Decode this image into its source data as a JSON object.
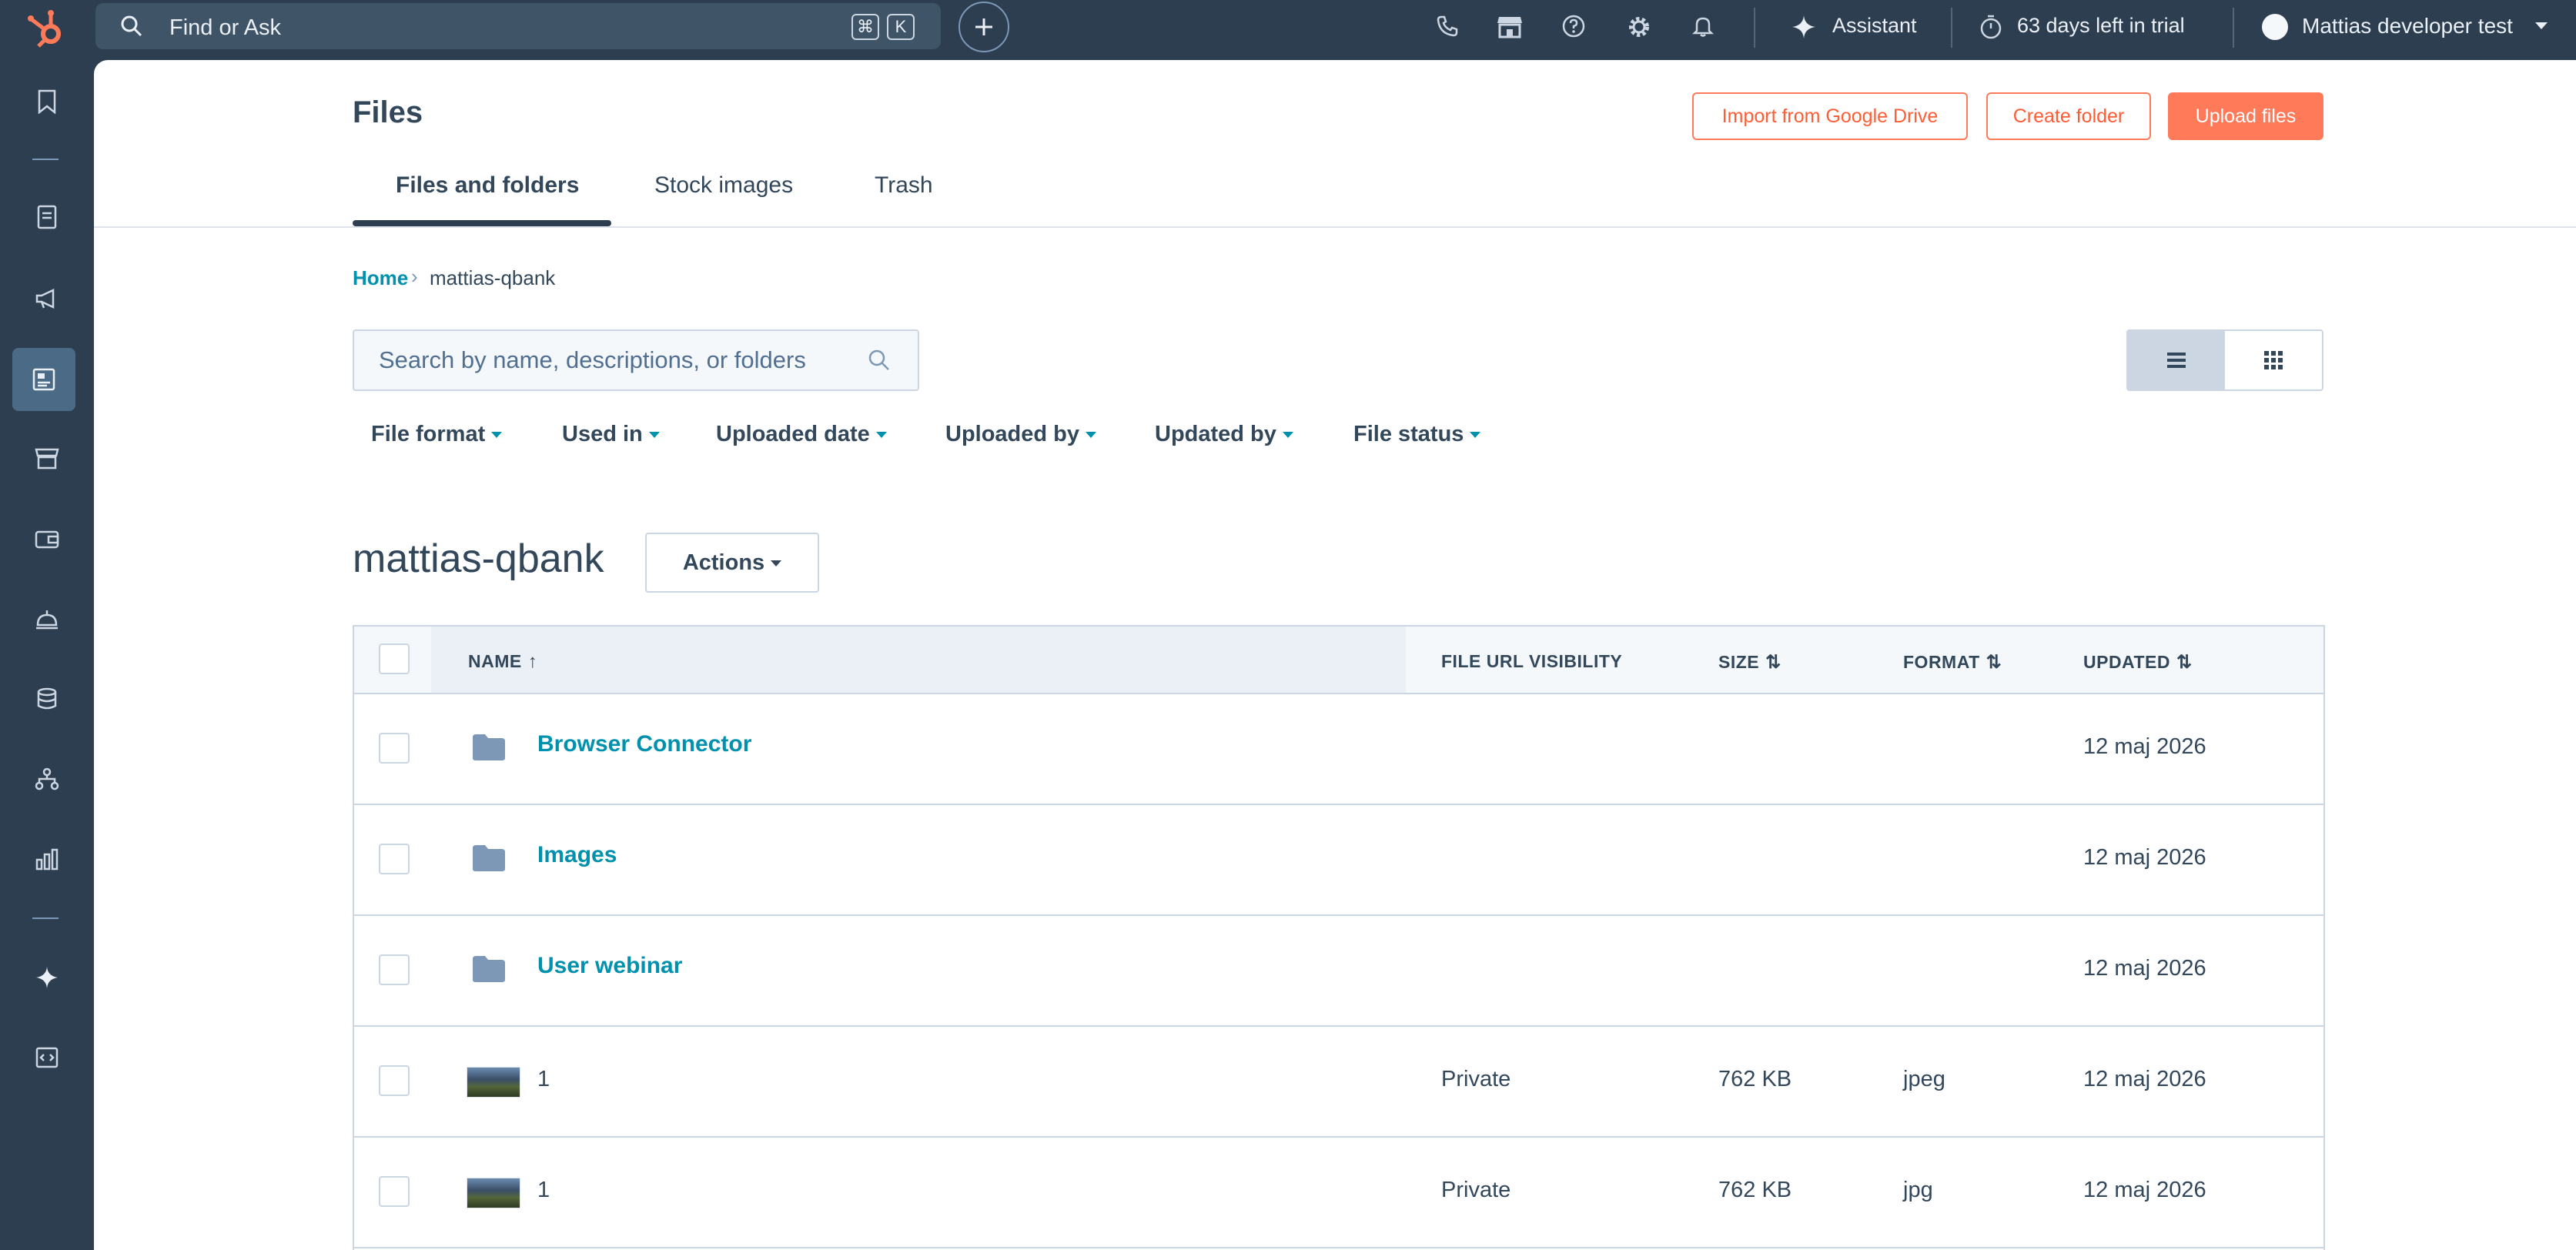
{
  "topbar": {
    "search_placeholder": "Find or Ask",
    "shortcut_cmd": "⌘",
    "shortcut_key": "K",
    "assistant_label": "Assistant",
    "trial_label": "63 days left in trial",
    "account_name": "Mattias developer test"
  },
  "page": {
    "title": "Files",
    "buttons": {
      "import": "Import from Google Drive",
      "create_folder": "Create folder",
      "upload": "Upload files"
    },
    "tabs": [
      "Files and folders",
      "Stock images",
      "Trash"
    ],
    "breadcrumb": {
      "home": "Home",
      "separator": "›",
      "current": "mattias-qbank"
    },
    "search_placeholder": "Search by name, descriptions, or folders",
    "filters": [
      "File format",
      "Used in",
      "Uploaded date",
      "Uploaded by",
      "Updated by",
      "File status"
    ],
    "folder_title": "mattias-qbank",
    "actions_label": "Actions"
  },
  "table": {
    "columns": {
      "name": "NAME",
      "visibility": "FILE URL VISIBILITY",
      "size": "SIZE",
      "format": "FORMAT",
      "updated": "UPDATED"
    },
    "rows": [
      {
        "type": "folder",
        "name": "Browser Connector",
        "visibility": "",
        "size": "",
        "format": "",
        "updated": "12 maj 2026"
      },
      {
        "type": "folder",
        "name": "Images",
        "visibility": "",
        "size": "",
        "format": "",
        "updated": "12 maj 2026"
      },
      {
        "type": "folder",
        "name": "User webinar",
        "visibility": "",
        "size": "",
        "format": "",
        "updated": "12 maj 2026"
      },
      {
        "type": "image",
        "name": "1",
        "visibility": "Private",
        "size": "762 KB",
        "format": "jpeg",
        "updated": "12 maj 2026"
      },
      {
        "type": "image",
        "name": "1",
        "visibility": "Private",
        "size": "762 KB",
        "format": "jpg",
        "updated": "12 maj 2026"
      }
    ]
  },
  "colors": {
    "nav_bg": "#2d3e50",
    "accent_orange": "#ff7a59",
    "link_teal": "#0091ae",
    "text": "#33475b",
    "border": "#cbd6e2"
  },
  "icons": {
    "logo": "hubspot-sprocket-icon",
    "topbar": [
      "search-icon",
      "plus-icon",
      "phone-icon",
      "marketplace-icon",
      "help-icon",
      "settings-icon",
      "notifications-icon",
      "sparkle-icon",
      "timer-icon",
      "avatar",
      "chevron-down-icon"
    ],
    "sidebar": [
      "bookmark-icon",
      "contacts-icon",
      "marketing-icon",
      "content-icon",
      "commerce-icon",
      "sales-icon",
      "service-icon",
      "data-icon",
      "automation-icon",
      "reporting-icon",
      "breeze-icon",
      "development-icon"
    ],
    "view_toggle": [
      "list-view-icon",
      "grid-view-icon"
    ]
  }
}
